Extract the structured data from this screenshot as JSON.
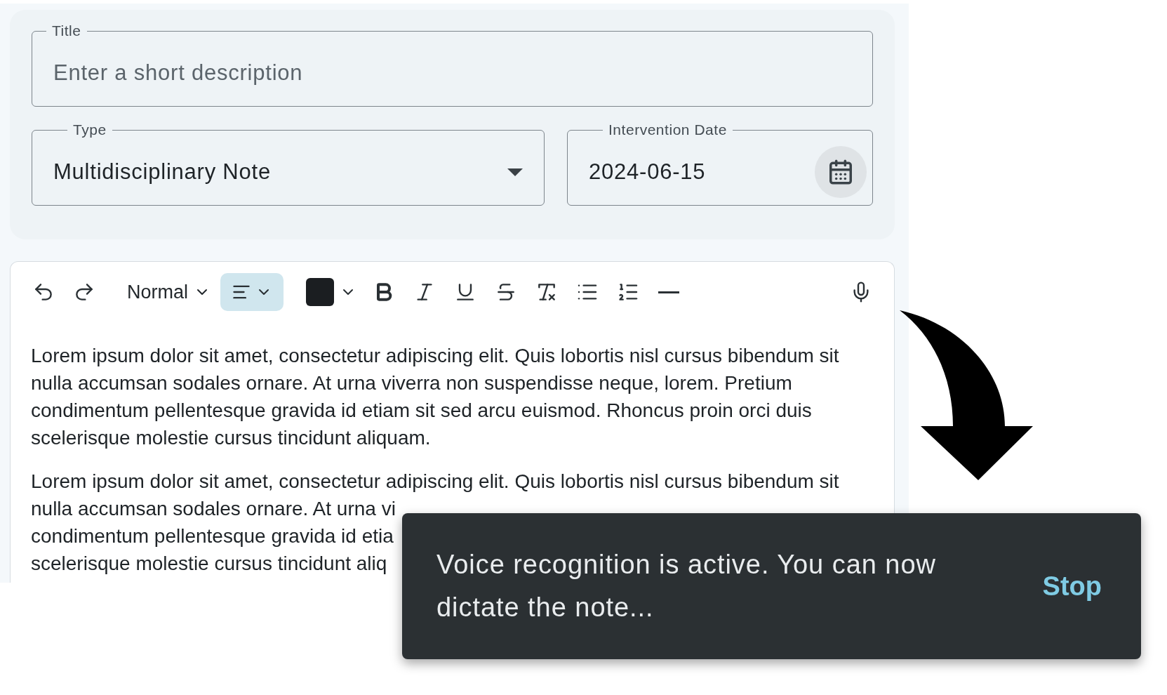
{
  "form": {
    "title": {
      "label": "Title",
      "placeholder": "Enter a short description"
    },
    "type": {
      "label": "Type",
      "value": "Multidisciplinary Note"
    },
    "date": {
      "label": "Intervention Date",
      "value": "2024-06-15"
    }
  },
  "toolbar": [
    {
      "kind": "undo"
    },
    {
      "kind": "redo"
    },
    {
      "kind": "style",
      "label": "Normal"
    },
    {
      "kind": "align",
      "selected": true
    },
    {
      "kind": "color",
      "color": "#1b1e21"
    },
    {
      "kind": "bold",
      "selected": false
    },
    {
      "kind": "italic",
      "selected": false
    },
    {
      "kind": "underline",
      "selected": false
    },
    {
      "kind": "strike",
      "selected": false
    },
    {
      "kind": "clear",
      "selected": false
    },
    {
      "kind": "bullets",
      "selected": false
    },
    {
      "kind": "numbers",
      "selected": false
    },
    {
      "kind": "rule",
      "selected": false
    },
    {
      "kind": "mic",
      "selected": false
    }
  ],
  "paragraphs": [
    {
      "lines": [
        "Lorem ipsum dolor sit amet, consectetur adipiscing elit. Quis lobortis nisl cursus bibendum sit",
        "nulla accumsan sodales ornare. At urna viverra non suspendisse neque, lorem. Pretium",
        "condimentum pellentesque gravida id etiam sit sed arcu euismod. Rhoncus proin orci duis",
        "scelerisque molestie cursus tincidunt aliquam."
      ]
    },
    {
      "lines": [
        "Lorem ipsum dolor sit amet, consectetur adipiscing elit. Quis lobortis nisl cursus bibendum sit",
        "nulla accumsan sodales ornare. At urna vi",
        "condimentum pellentesque gravida id etia",
        "scelerisque molestie cursus tincidunt aliq"
      ]
    }
  ],
  "toast": {
    "message": "Voice recognition is active. You can now dictate the note...",
    "action": "Stop"
  }
}
